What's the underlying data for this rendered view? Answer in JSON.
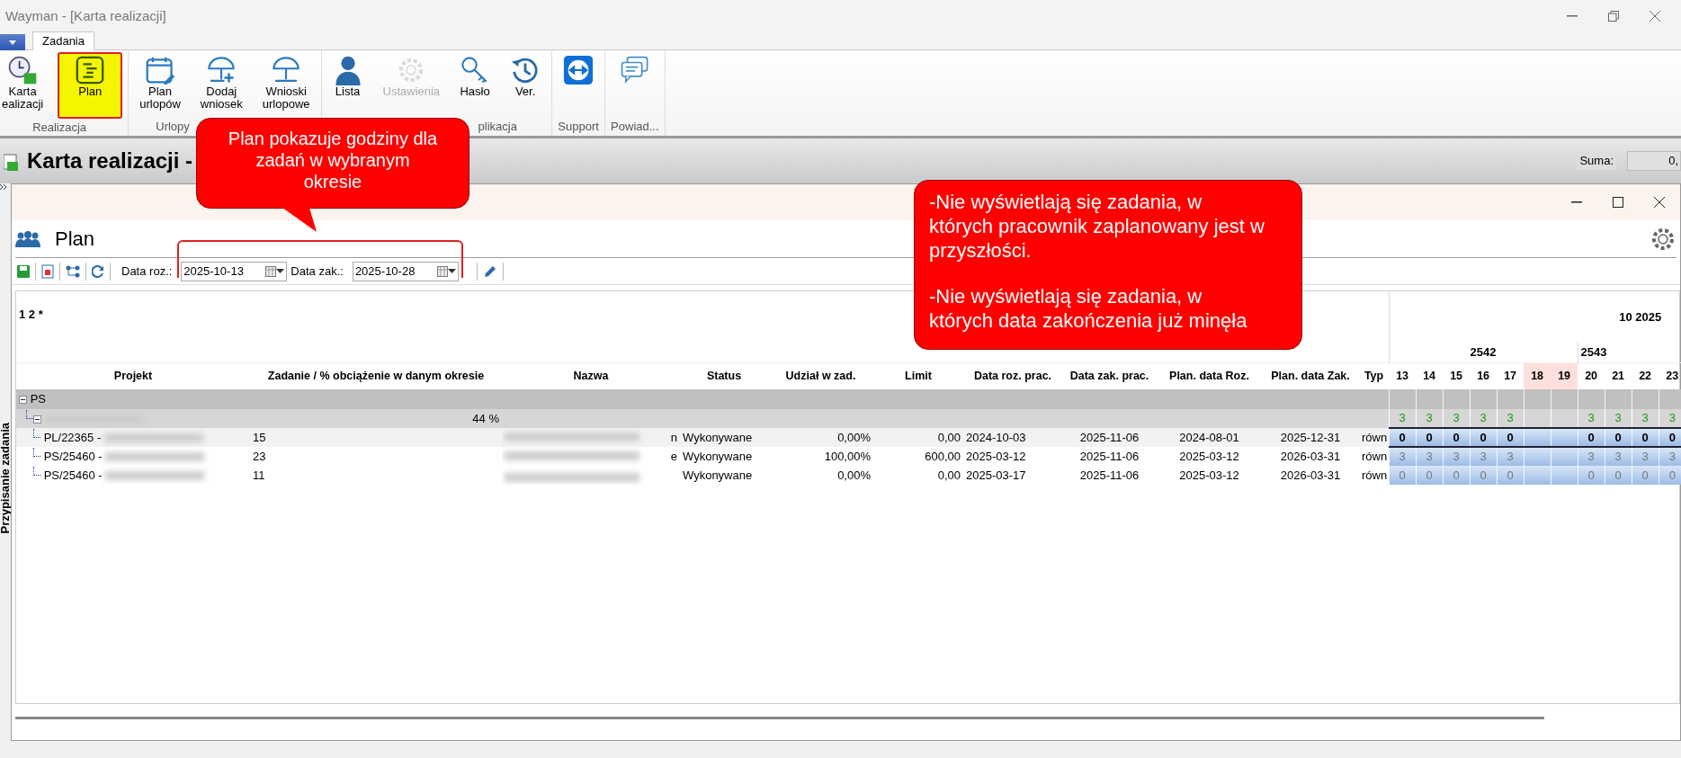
{
  "window": {
    "title": "Wayman - [Karta realizacji]"
  },
  "ribbon": {
    "tabs": [
      {
        "label": "Zadania",
        "selected": true
      }
    ],
    "groups": [
      {
        "label": "Realizacja",
        "buttons": [
          {
            "lines": [
              "Karta",
              "ealizacji"
            ],
            "selected": false,
            "disabled": false
          },
          {
            "lines": [
              "Plan"
            ],
            "selected": true,
            "disabled": false
          }
        ]
      },
      {
        "label": "Urlopy",
        "buttons": [
          {
            "lines": [
              "Plan",
              "urlopów"
            ],
            "selected": false,
            "disabled": false
          },
          {
            "lines": [
              "Dodaj",
              "wniosek"
            ],
            "selected": false,
            "disabled": false
          },
          {
            "lines": [
              "Wnioski",
              "urlopowe"
            ],
            "selected": false,
            "disabled": false
          }
        ]
      },
      {
        "label": "plikacja",
        "buttons": [
          {
            "lines": [
              "Lista"
            ],
            "selected": false,
            "disabled": false
          },
          {
            "lines": [
              "Ustawienia"
            ],
            "selected": false,
            "disabled": true
          },
          {
            "lines": [
              "Hasło"
            ],
            "selected": false,
            "disabled": false
          },
          {
            "lines": [
              "Ver."
            ],
            "selected": false,
            "disabled": false
          }
        ]
      },
      {
        "label": "Support",
        "buttons": [
          {
            "selected": false,
            "disabled": false
          }
        ]
      },
      {
        "label": "Powiad...",
        "buttons": [
          {
            "selected": false,
            "disabled": false
          }
        ]
      }
    ]
  },
  "page_header": {
    "title": "Karta realizacji -",
    "sum_label": "Suma:",
    "sum_value": "0,"
  },
  "side_tab": {
    "label": "Przypisanie zadania"
  },
  "plan_window": {
    "title": "Plan",
    "toolbar": {
      "start_label": "Data roz.:",
      "start_value": "2025-10-13",
      "end_label": "Data zak.:",
      "end_value": "2025-10-28"
    },
    "grid": {
      "corner": "1 2 *",
      "month": "10 2025",
      "weeks": [
        {
          "label": "2542"
        },
        {
          "label": "2543"
        }
      ],
      "columns": [
        "Projekt",
        "Zadanie / % obciążenie w danym okresie",
        "Nazwa",
        "Status",
        "Udział w zad.",
        "Limit",
        "Data roz. prac.",
        "Data zak. prac.",
        "Plan. data Roz.",
        "Plan. data Zak.",
        "Typ"
      ],
      "days": [
        {
          "label": "13",
          "weekend": false
        },
        {
          "label": "14",
          "weekend": false
        },
        {
          "label": "15",
          "weekend": false
        },
        {
          "label": "16",
          "weekend": false
        },
        {
          "label": "17",
          "weekend": false
        },
        {
          "label": "18",
          "weekend": true
        },
        {
          "label": "19",
          "weekend": true
        },
        {
          "label": "20",
          "weekend": false
        },
        {
          "label": "21",
          "weekend": false
        },
        {
          "label": "22",
          "weekend": false
        },
        {
          "label": "23",
          "weekend": false
        }
      ],
      "rows": [
        {
          "kind": "group",
          "label": "PS",
          "expanded": true
        },
        {
          "kind": "subgroup",
          "load": "44 %",
          "expanded": true,
          "hours": [
            "3",
            "3",
            "3",
            "3",
            "3",
            "3",
            "3",
            "3",
            "3"
          ]
        },
        {
          "kind": "task",
          "selected": true,
          "project": "PL/22365 -",
          "task": "15",
          "name_tail": "n",
          "status": "Wykonywane",
          "share": "0,00%",
          "limit": "0,00",
          "start": "2024-10-03",
          "end": "2025-11-06",
          "plan_start": "2024-08-01",
          "plan_end": "2025-12-31",
          "type": "równ",
          "hours": [
            "0",
            "0",
            "0",
            "0",
            "0",
            "0",
            "0",
            "0",
            "0"
          ]
        },
        {
          "kind": "task",
          "selected": false,
          "project": "PS/25460 -",
          "task": "23",
          "name_tail": "e",
          "status": "Wykonywane",
          "share": "100,00%",
          "limit": "600,00",
          "start": "2025-03-12",
          "end": "2025-11-06",
          "plan_start": "2025-03-12",
          "plan_end": "2026-03-31",
          "type": "równ",
          "hours": [
            "3",
            "3",
            "3",
            "3",
            "3",
            "3",
            "3",
            "3",
            "3"
          ]
        },
        {
          "kind": "task",
          "selected": false,
          "project": "PS/25460 -",
          "task": "11",
          "status": "Wykonywane",
          "share": "0,00%",
          "limit": "0,00",
          "start": "2025-03-17",
          "end": "2025-11-06",
          "plan_start": "2025-03-12",
          "plan_end": "2026-03-31",
          "type": "równ",
          "hours": [
            "0",
            "0",
            "0",
            "0",
            "0",
            "0",
            "0",
            "0",
            "0"
          ]
        }
      ]
    }
  },
  "annotations": [
    {
      "kind": "callout",
      "paragraphs": [
        "Plan pokazuje godziny dla zadań w wybranym okresie"
      ]
    },
    {
      "kind": "callout",
      "paragraphs": [
        "-Nie wyświetlają się zadania, w których pracownik zaplanowany jest w przyszłości.",
        "-Nie wyświetlają się zadania, w których data zakończenia już minęła"
      ]
    },
    {
      "kind": "highlight"
    }
  ]
}
